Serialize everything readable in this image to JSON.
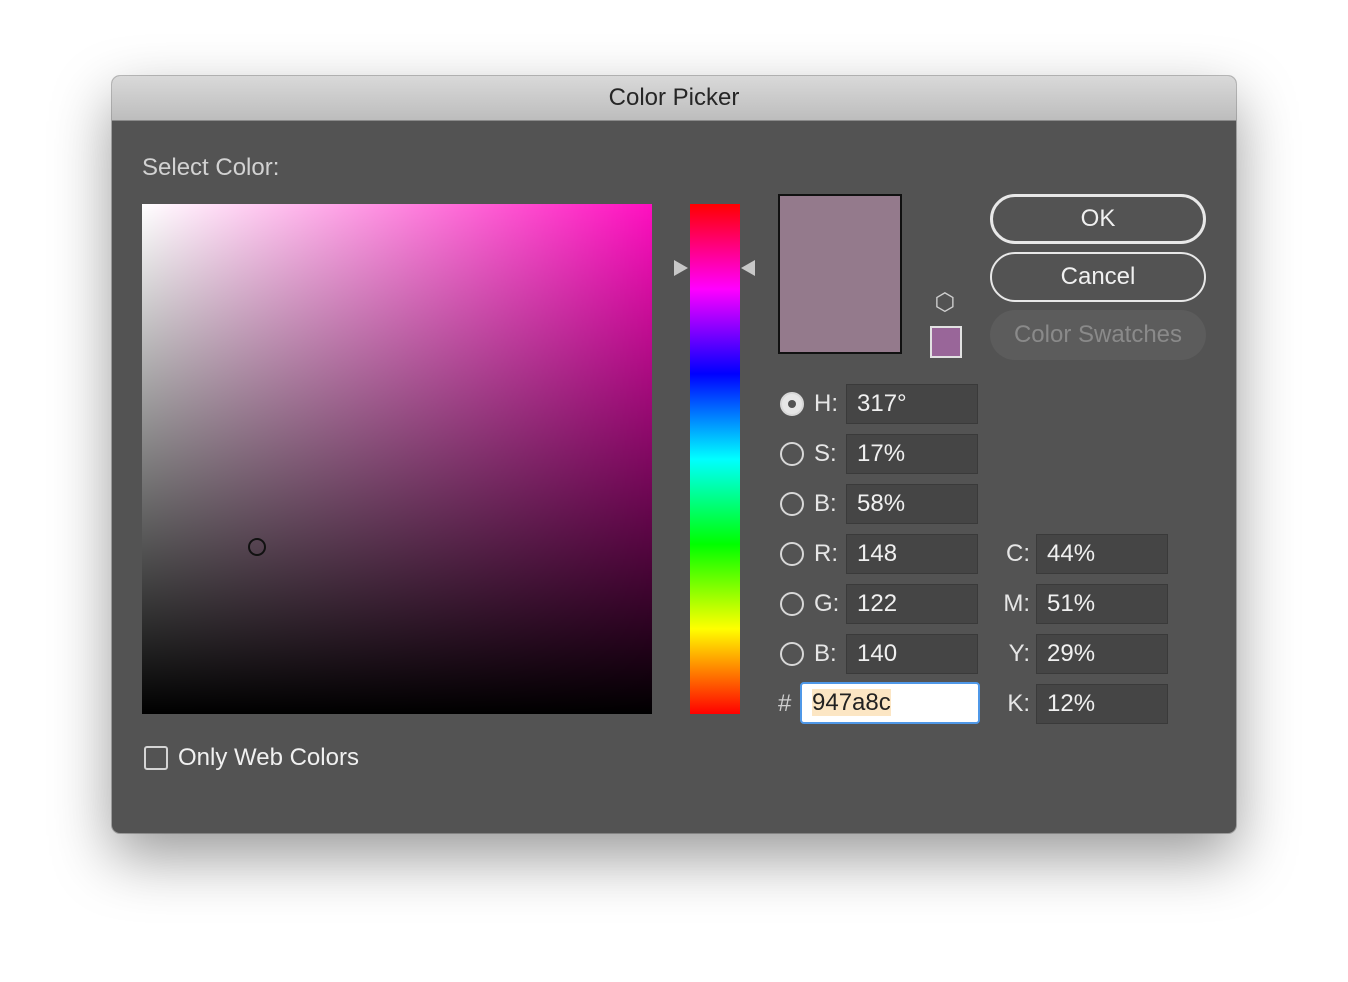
{
  "window": {
    "title": "Color Picker"
  },
  "picker": {
    "select_label": "Select Color:",
    "current_color": "#947a8c",
    "websafe_color": "#996699",
    "field_hue_color": "#ff0fc0"
  },
  "buttons": {
    "ok": "OK",
    "cancel": "Cancel",
    "swatches": "Color Swatches"
  },
  "hsb": {
    "h": {
      "label": "H:",
      "value": "317°",
      "selected": true
    },
    "s": {
      "label": "S:",
      "value": "17%",
      "selected": false
    },
    "b": {
      "label": "B:",
      "value": "58%",
      "selected": false
    }
  },
  "rgb": {
    "r": {
      "label": "R:",
      "value": "148",
      "selected": false
    },
    "g": {
      "label": "G:",
      "value": "122",
      "selected": false
    },
    "b": {
      "label": "B:",
      "value": "140",
      "selected": false
    }
  },
  "cmyk": {
    "c": {
      "label": "C:",
      "value": "44%"
    },
    "m": {
      "label": "M:",
      "value": "51%"
    },
    "y": {
      "label": "Y:",
      "value": "29%"
    },
    "k": {
      "label": "K:",
      "value": "12%"
    }
  },
  "hex": {
    "prefix": "#",
    "value": "947a8c"
  },
  "options": {
    "only_web_colors_label": "Only Web Colors",
    "only_web_colors_checked": false
  },
  "icons": {
    "gamut": "cube-icon",
    "hue_slider_arrows": "triangle-arrow-icon"
  }
}
